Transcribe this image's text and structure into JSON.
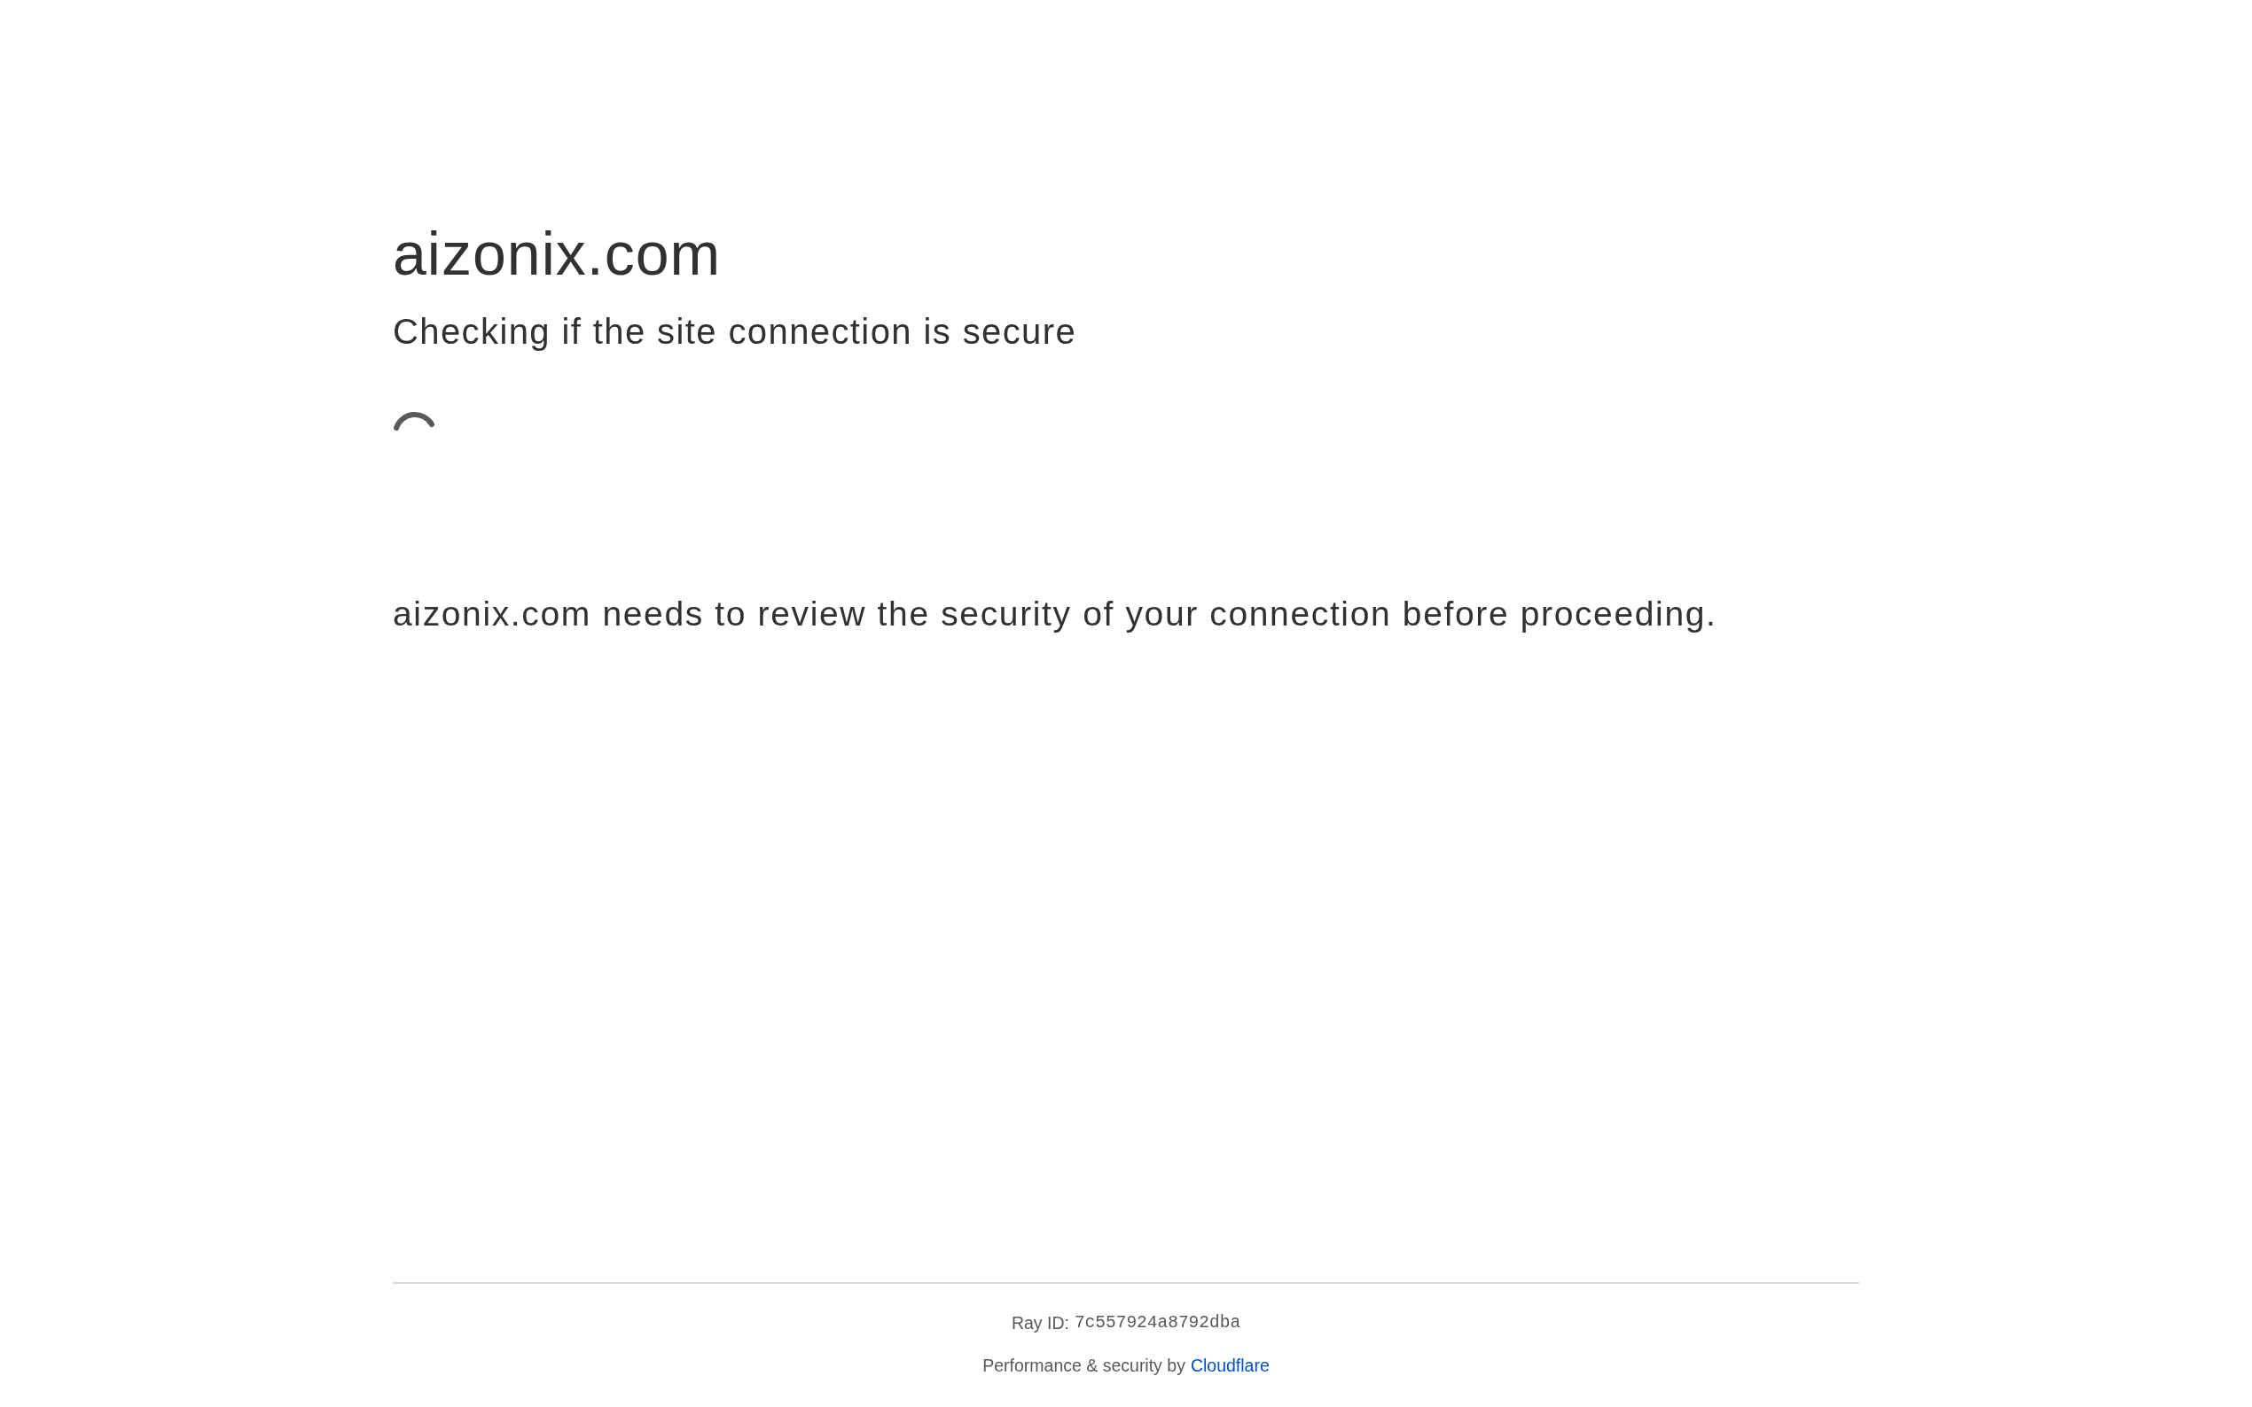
{
  "heading": "aizonix.com",
  "subheading": "Checking if the site connection is secure",
  "message": "aizonix.com needs to review the security of your connection before proceeding.",
  "footer": {
    "ray_id_label": "Ray ID:",
    "ray_id": "7c557924a8792dba",
    "credit": "Performance & security by",
    "link": "Cloudflare"
  }
}
